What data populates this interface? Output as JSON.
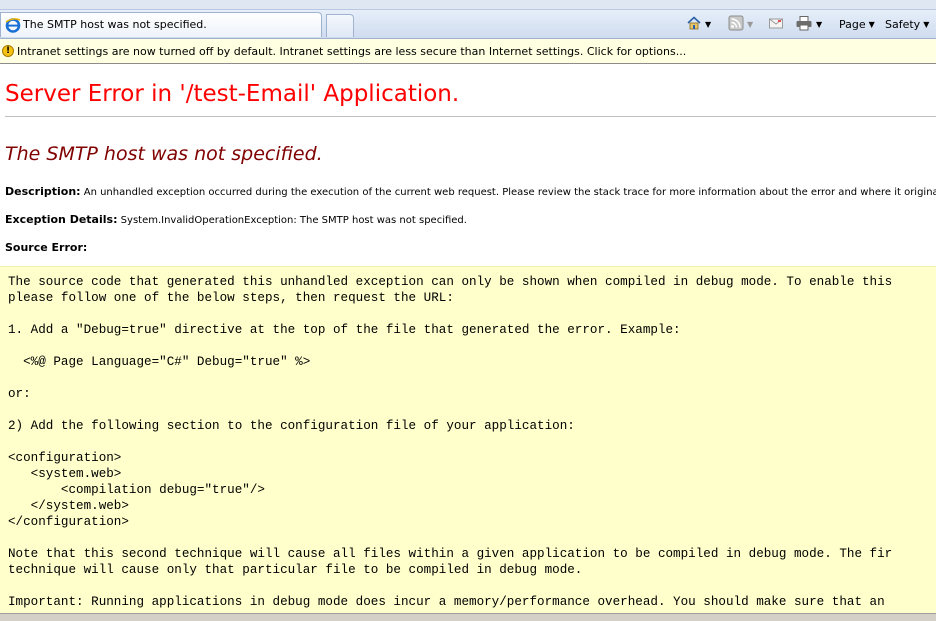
{
  "browser": {
    "tab_title": "The SMTP host was not specified.",
    "commands": {
      "page_label": "Page",
      "safety_label": "Safety"
    }
  },
  "infobar": {
    "text": "Intranet settings are now turned off by default. Intranet settings are less secure than Internet settings. Click for options..."
  },
  "page": {
    "heading": "Server Error in '/test-Email' Application.",
    "error_title": "The SMTP host was not specified.",
    "description_label": "Description:",
    "description_text": "An unhandled exception occurred during the execution of the current web request. Please review the stack trace for more information about the error and where it originated in",
    "exception_label": "Exception Details:",
    "exception_text": "System.InvalidOperationException: The SMTP host was not specified.",
    "source_error_label": "Source Error:",
    "source_lines": [
      "The source code that generated this unhandled exception can only be shown when compiled in debug mode. To enable this",
      "please follow one of the below steps, then request the URL:",
      "",
      "1. Add a \"Debug=true\" directive at the top of the file that generated the error. Example:",
      "",
      "  <%@ Page Language=\"C#\" Debug=\"true\" %>",
      "",
      "or:",
      "",
      "2) Add the following section to the configuration file of your application:",
      "",
      "<configuration>",
      "   <system.web>",
      "       <compilation debug=\"true\"/>",
      "   </system.web>",
      "</configuration>",
      "",
      "Note that this second technique will cause all files within a given application to be compiled in debug mode. The fir",
      "technique will cause only that particular file to be compiled in debug mode.",
      "",
      "Important: Running applications in debug mode does incur a memory/performance overhead. You should make sure that an"
    ]
  },
  "colors": {
    "heading": "#ff0000",
    "error_title": "#800000",
    "source_bg": "#ffffcc",
    "infobar_bg": "#ffffe1"
  }
}
